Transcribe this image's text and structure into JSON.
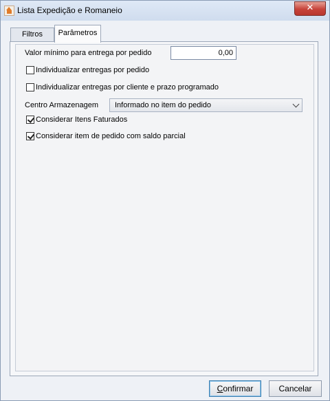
{
  "window": {
    "title": "Lista Expedição e Romaneio",
    "close_label": "✕"
  },
  "tabs": [
    {
      "label": "Filtros",
      "active": false
    },
    {
      "label": "Parâmetros",
      "active": true
    }
  ],
  "parametros": {
    "valor_minimo_label": "Valor mínimo para entrega por pedido",
    "valor_minimo_value": "0,00",
    "checkboxes": [
      {
        "label": "Individualizar entregas por pedido",
        "checked": false
      },
      {
        "label": "Individualizar entregas por cliente e prazo programado",
        "checked": false
      },
      {
        "label": "Considerar Itens Faturados",
        "checked": true
      },
      {
        "label": "Considerar item de pedido com saldo parcial",
        "checked": true
      }
    ],
    "centro_armazenagem_label": "Centro Armazenagem",
    "centro_armazenagem_selected": "Informado no item do pedido"
  },
  "buttons": {
    "confirmar_first": "C",
    "confirmar_rest": "onfirmar",
    "cancelar": "Cancelar"
  }
}
